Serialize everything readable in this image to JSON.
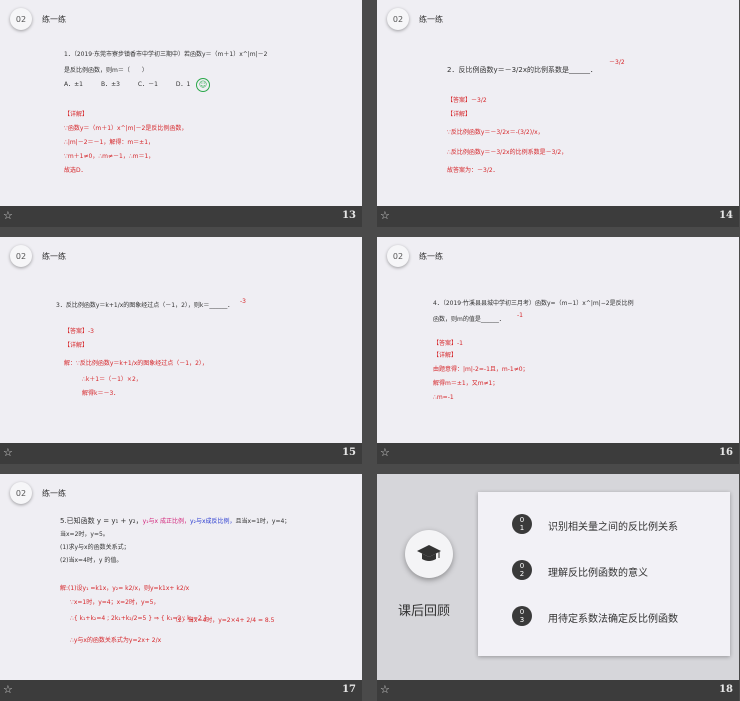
{
  "section_num": "02",
  "section_title": "练一练",
  "star_glyph": "☆",
  "slide13": {
    "page": "13",
    "q_line1": "1．（2019·东莞市寮步镇香市中学初三期中）若函数y＝（m＋1）x^|m|－2",
    "q_line2": "是反比例函数，则m＝（　　）",
    "options": "A．±1　　　B．±3　　　C．－1　　　D．1",
    "ans_title": "【详解】",
    "ans_lines": [
      "∵函数y＝（m＋1）x^|m|－2是反比例函数，",
      "∴|m|－2＝－1，解得：m＝±1，",
      "∵m＋1≠0，∴m≠－1，∴m＝1，",
      "故选D．"
    ]
  },
  "slide14": {
    "page": "14",
    "question": "2．反比例函数y＝－3/2x的比例系数是______．",
    "blank_answer": "－3/2",
    "ans_lines": [
      "【答案】－3/2",
      "【详解】",
      "∵反比例函数y＝－3/2x＝-(3/2)/x，",
      "∴反比例函数y＝－3/2x的比例系数是－3/2，",
      "故答案为：－3/2．"
    ]
  },
  "slide15": {
    "page": "15",
    "question": "3．反比例函数y＝k+1/x的图象经过点（－1，2），则k＝______．",
    "blank_answer": "-3",
    "ans_lines": [
      "【答案】-3",
      "【详解】",
      "解：∵反比例函数y＝k+1/x的图象经过点（－1，2），",
      "∴k＋1＝（－1）×2，",
      "解得k＝－3．"
    ]
  },
  "slide16": {
    "page": "16",
    "q_line1": "4．（2019·竹溪县县城中学初三月考）函数y=（m−1）x^|m|−2是反比例",
    "q_line2": "函数，则m的值是______．",
    "blank_answer": "-1",
    "ans_lines": [
      "【答案】-1",
      "【详解】",
      "由题意得：|m|-2=-1且，m-1≠0；",
      "解得m＝±1，又m≠1；",
      "∴m=-1"
    ]
  },
  "slide17": {
    "page": "17",
    "q_a": "5.已知函数 y = y₁ + y₂，",
    "q_b": "y₁与x 成正比例，",
    "q_c": "y₂与x成反比例，",
    "q_d": "且当x=1时，y=4；",
    "q_line2": "当x=2时，y=5。",
    "q_line3": "(1)求y与x的函数关系式；",
    "q_line4": "(2)当x=4时，y 的值。",
    "sol_lines": [
      "解:(1)设y₁ =k1x，y₂= k2/x，则y=k1x+ k2/x",
      "∵x=1时，y=4；x=2时，y=5，",
      "∴{ k₁+k₂=4 ; 2k₁+k₂/2=5 } ⇒ { k₁=2 ; k₂=2 }",
      "（2）当x=4时，y=2×4+ 2/4 = 8.5",
      "∴y与x的函数关系式为y=2x+ 2/x"
    ]
  },
  "slide18": {
    "page": "18",
    "label": "课后回顾",
    "items": [
      {
        "num_a": "0",
        "num_b": "1",
        "text": "识别相关量之间的反比例关系"
      },
      {
        "num_a": "0",
        "num_b": "2",
        "text": "理解反比例函数的意义"
      },
      {
        "num_a": "0",
        "num_b": "3",
        "text": "用待定系数法确定反比例函数"
      }
    ]
  }
}
